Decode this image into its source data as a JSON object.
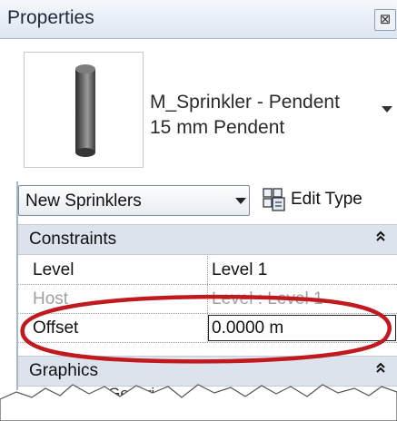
{
  "panel": {
    "title": "Properties",
    "close_glyph": "⊠"
  },
  "type_selector": {
    "family": "M_Sprinkler - Pendent",
    "type": "15 mm Pendent",
    "thumbnail_icon": "sprinkler-cylinder-icon"
  },
  "filter": {
    "selected": "New Sprinklers",
    "edit_type_label": "Edit Type",
    "edit_type_icon": "edit-type-icon"
  },
  "sections": {
    "constraints": {
      "title": "Constraints",
      "toggle": "≈"
    },
    "graphics": {
      "title": "Graphics",
      "toggle": "≈"
    }
  },
  "properties": {
    "level": {
      "name": "Level",
      "value": "Level 1"
    },
    "host": {
      "name": "Host",
      "value": "Level : Level 1"
    },
    "offset": {
      "name": "Offset",
      "value": "0.0000 m"
    }
  },
  "cut_off_row": {
    "name": "...Generi...",
    "value": "..."
  },
  "colors": {
    "highlight_ellipse": "#c0191e",
    "header_bg": "#dde3ec",
    "disabled_text": "#a0a0a0"
  }
}
